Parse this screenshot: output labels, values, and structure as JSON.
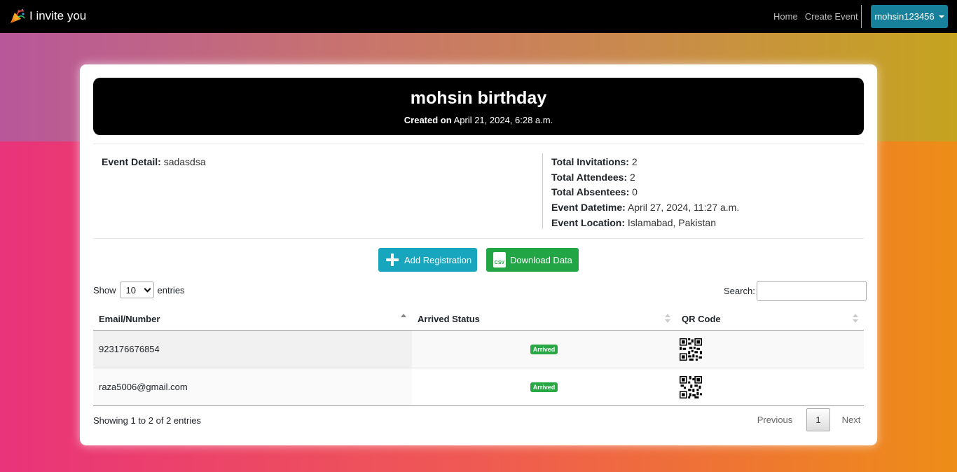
{
  "nav": {
    "brand": "I invite you",
    "links": [
      "Home",
      "Create Event"
    ],
    "user": "mohsin123456"
  },
  "event": {
    "title": "mohsin birthday",
    "created_label": "Created on",
    "created_value": "April 21, 2024, 6:28 a.m.",
    "detail_label": "Event Detail:",
    "detail_value": "sadasdsa",
    "stats": [
      {
        "label": "Total Invitations:",
        "value": "2"
      },
      {
        "label": "Total Attendees:",
        "value": "2"
      },
      {
        "label": "Total Absentees:",
        "value": "0"
      },
      {
        "label": "Event Datetime:",
        "value": "April 27, 2024, 11:27 a.m."
      },
      {
        "label": "Event Location:",
        "value": "Islamabad, Pakistan"
      }
    ]
  },
  "actions": {
    "add_label": "Add Registration",
    "download_label": "Download Data",
    "csv_icon_text": "CSV"
  },
  "table_controls": {
    "show_label": "Show",
    "entries_label": "entries",
    "page_size": "10",
    "search_label": "Search:"
  },
  "table": {
    "headers": [
      "Email/Number",
      "Arrived Status",
      "QR Code"
    ],
    "rows": [
      {
        "contact": "923176676854",
        "status": "Arrived"
      },
      {
        "contact": "raza5006@gmail.com",
        "status": "Arrived"
      }
    ]
  },
  "footer": {
    "info": "Showing 1 to 2 of 2 entries",
    "previous": "Previous",
    "page": "1",
    "next": "Next"
  },
  "colors": {
    "navbar": "#000000",
    "user_button": "#17819b",
    "add_button": "#18a6be",
    "download_button": "#21a545",
    "badge": "#28a745"
  }
}
